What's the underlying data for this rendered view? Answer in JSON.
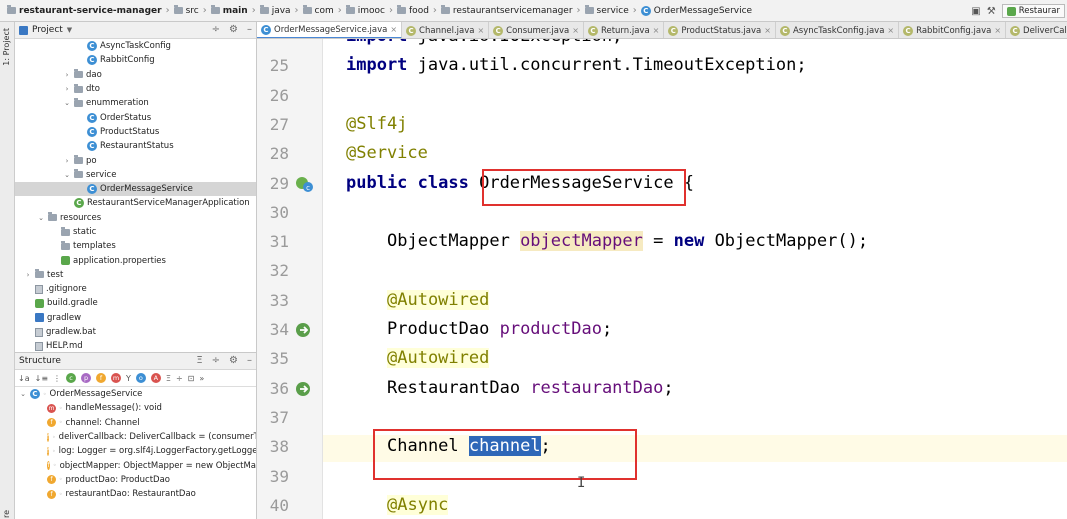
{
  "breadcrumb": [
    "restaurant-service-manager",
    "src",
    "main",
    "java",
    "com",
    "imooc",
    "food",
    "restaurantservicemanager",
    "service",
    "OrderMessageService"
  ],
  "run_config": "Restaurar",
  "left_strip": {
    "project_label": "1: Project",
    "bottom_label": "re"
  },
  "project_panel": {
    "title": "Project",
    "items": [
      {
        "label": "AsyncTaskConfig",
        "icon": "class-icon",
        "indent": 5
      },
      {
        "label": "RabbitConfig",
        "icon": "class-icon",
        "indent": 5
      },
      {
        "label": "dao",
        "icon": "folder-icon",
        "indent": 4,
        "arrow": "›"
      },
      {
        "label": "dto",
        "icon": "folder-icon",
        "indent": 4,
        "arrow": "›"
      },
      {
        "label": "enummeration",
        "icon": "folder-icon",
        "indent": 4,
        "arrow": "⌄"
      },
      {
        "label": "OrderStatus",
        "icon": "class-icon",
        "indent": 5
      },
      {
        "label": "ProductStatus",
        "icon": "class-icon",
        "indent": 5
      },
      {
        "label": "RestaurantStatus",
        "icon": "class-icon",
        "indent": 5
      },
      {
        "label": "po",
        "icon": "folder-icon",
        "indent": 4,
        "arrow": "›"
      },
      {
        "label": "service",
        "icon": "folder-icon",
        "indent": 4,
        "arrow": "⌄"
      },
      {
        "label": "OrderMessageService",
        "icon": "class-icon",
        "indent": 5,
        "selected": true
      },
      {
        "label": "RestaurantServiceManagerApplication",
        "icon": "spring-class-icon",
        "indent": 4
      },
      {
        "label": "resources",
        "icon": "folder-icon",
        "indent": 2,
        "arrow": "⌄"
      },
      {
        "label": "static",
        "icon": "folder-icon",
        "indent": 3
      },
      {
        "label": "templates",
        "icon": "folder-icon",
        "indent": 3
      },
      {
        "label": "application.properties",
        "icon": "properties-icon",
        "indent": 3
      },
      {
        "label": "test",
        "icon": "folder-icon",
        "indent": 1,
        "arrow": "›"
      },
      {
        "label": ".gitignore",
        "icon": "file-icon",
        "indent": 1
      },
      {
        "label": "build.gradle",
        "icon": "gradle-icon",
        "indent": 1
      },
      {
        "label": "gradlew",
        "icon": "terminal-icon",
        "indent": 1
      },
      {
        "label": "gradlew.bat",
        "icon": "file-icon",
        "indent": 1
      },
      {
        "label": "HELP.md",
        "icon": "file-icon",
        "indent": 1
      }
    ]
  },
  "structure_panel": {
    "title": "Structure",
    "root": "OrderMessageService",
    "items": [
      {
        "label": "handleMessage(): void",
        "kind": "m"
      },
      {
        "label": "channel: Channel",
        "kind": "f"
      },
      {
        "label": "deliverCallback: DeliverCallback = (consumerTa",
        "kind": "f"
      },
      {
        "label": "log: Logger = org.slf4j.LoggerFactory.getLogge",
        "kind": "f"
      },
      {
        "label": "objectMapper: ObjectMapper = new ObjectMa",
        "kind": "f"
      },
      {
        "label": "productDao: ProductDao",
        "kind": "f"
      },
      {
        "label": "restaurantDao: RestaurantDao",
        "kind": "f"
      }
    ]
  },
  "tabs": [
    {
      "label": "OrderMessageService.java",
      "active": true
    },
    {
      "label": "Channel.java"
    },
    {
      "label": "Consumer.java"
    },
    {
      "label": "Return.java"
    },
    {
      "label": "ProductStatus.java"
    },
    {
      "label": "AsyncTaskConfig.java"
    },
    {
      "label": "RabbitConfig.java"
    },
    {
      "label": "DeliverCallback.java"
    }
  ],
  "code_lines": [
    {
      "n": "",
      "text": "import java.io.IOException;"
    },
    {
      "n": "25",
      "text": "import java.util.concurrent.TimeoutException;"
    },
    {
      "n": "26",
      "text": ""
    },
    {
      "n": "27",
      "text": "@Slf4j"
    },
    {
      "n": "28",
      "text": "@Service"
    },
    {
      "n": "29",
      "text": "public class OrderMessageService {"
    },
    {
      "n": "30",
      "text": ""
    },
    {
      "n": "31",
      "text": "ObjectMapper objectMapper = new ObjectMapper();"
    },
    {
      "n": "32",
      "text": ""
    },
    {
      "n": "33",
      "text": "@Autowired"
    },
    {
      "n": "34",
      "text": "ProductDao productDao;"
    },
    {
      "n": "35",
      "text": "@Autowired"
    },
    {
      "n": "36",
      "text": "RestaurantDao restaurantDao;"
    },
    {
      "n": "37",
      "text": ""
    },
    {
      "n": "38",
      "text": "Channel channel;"
    },
    {
      "n": "39",
      "text": ""
    },
    {
      "n": "40",
      "text": "@Async"
    }
  ],
  "colors": {
    "highlight_box": "#e0312e",
    "selection": "#2e67b8",
    "keyword": "#000080",
    "annotation": "#808000",
    "field": "#660e7a"
  }
}
